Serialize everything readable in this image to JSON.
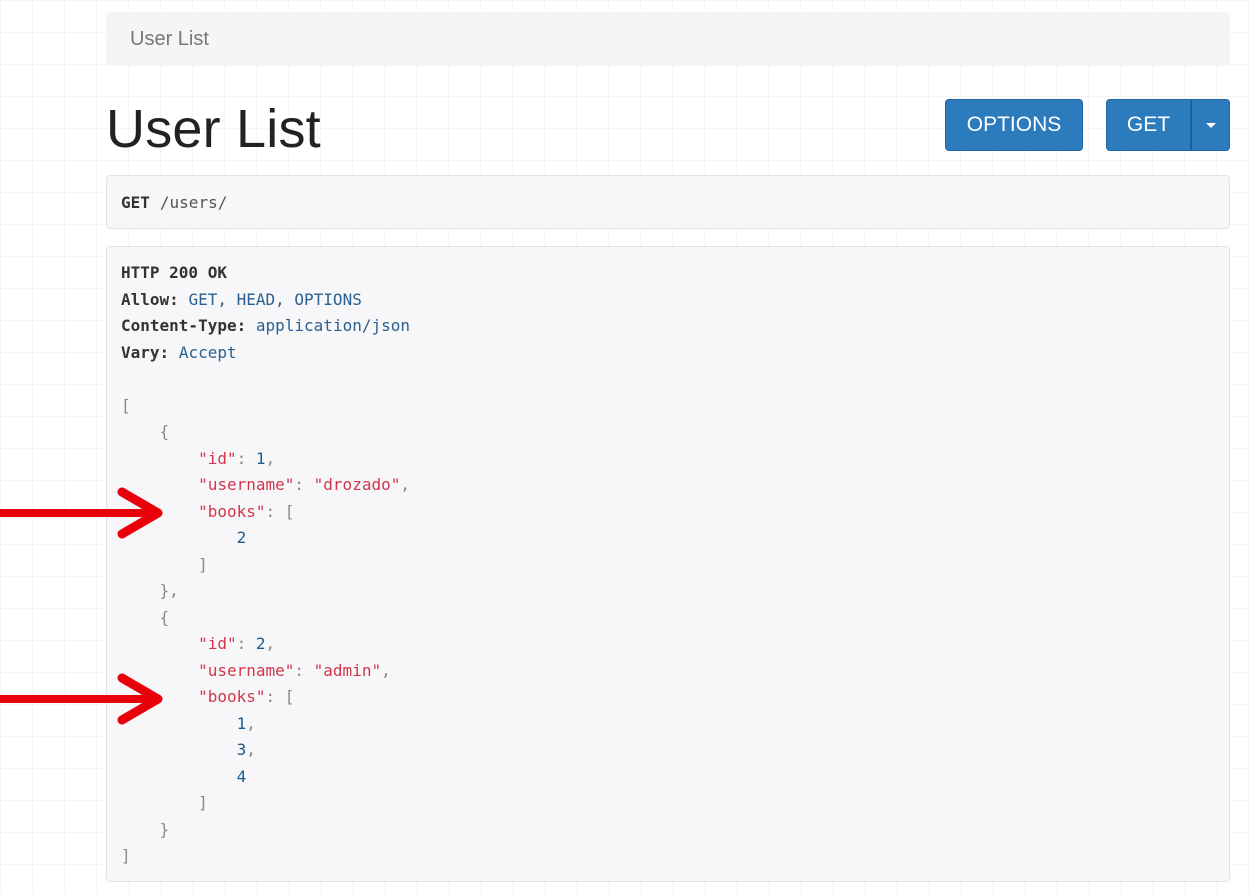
{
  "breadcrumb": {
    "items": [
      "User List"
    ]
  },
  "page": {
    "title": "User List"
  },
  "buttons": {
    "options_label": "OPTIONS",
    "get_label": "GET"
  },
  "request": {
    "method": "GET",
    "path": "/users/"
  },
  "response": {
    "status": "HTTP 200 OK",
    "headers": [
      {
        "key": "Allow:",
        "value": "GET, HEAD, OPTIONS"
      },
      {
        "key": "Content-Type:",
        "value": "application/json"
      },
      {
        "key": "Vary:",
        "value": "Accept"
      }
    ],
    "body": {
      "open_bracket": "[",
      "close_bracket": "]",
      "users": [
        {
          "open": "{",
          "close": "},",
          "id_key": "\"id\"",
          "id_value": "1",
          "username_key": "\"username\"",
          "username_value": "\"drozado\"",
          "books_key": "\"books\"",
          "books_open": "[",
          "books_close": "]",
          "books": [
            "2"
          ]
        },
        {
          "open": "{",
          "close": "}",
          "id_key": "\"id\"",
          "id_value": "2",
          "username_key": "\"username\"",
          "username_value": "\"admin\"",
          "books_key": "\"books\"",
          "books_open": "[",
          "books_close": "]",
          "books": [
            "1",
            "3",
            "4"
          ]
        }
      ]
    }
  },
  "annotations": {
    "arrow_color": "#e8000b"
  }
}
